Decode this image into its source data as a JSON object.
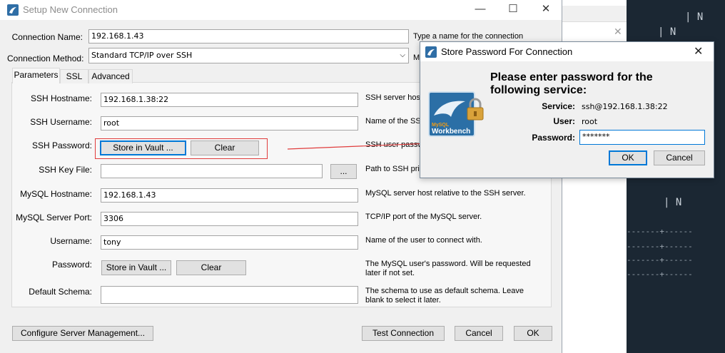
{
  "main": {
    "title": "Setup New Connection",
    "connection_name_label": "Connection Name:",
    "connection_name_value": "192.168.1.43",
    "connection_name_hint": "Type a name for the connection",
    "connection_method_label": "Connection Method:",
    "connection_method_value": "Standard TCP/IP over SSH",
    "connection_method_hint": "M",
    "tabs": [
      {
        "label": "Parameters"
      },
      {
        "label": "SSL"
      },
      {
        "label": "Advanced"
      }
    ],
    "fields": {
      "ssh_hostname_label": "SSH Hostname:",
      "ssh_hostname_value": "192.168.1.38:22",
      "ssh_hostname_hint": "SSH server host",
      "ssh_username_label": "SSH Username:",
      "ssh_username_value": "root",
      "ssh_username_hint": "Name of the SS",
      "ssh_password_label": "SSH Password:",
      "ssh_password_hint": "SSH user passw",
      "ssh_keyfile_label": "SSH Key File:",
      "ssh_keyfile_value": "",
      "ssh_keyfile_hint": "Path to SSH priv",
      "mysql_hostname_label": "MySQL Hostname:",
      "mysql_hostname_value": "192.168.1.43",
      "mysql_hostname_hint": "MySQL server host relative to the SSH server.",
      "mysql_port_label": "MySQL Server Port:",
      "mysql_port_value": "3306",
      "mysql_port_hint": "TCP/IP port of the MySQL server.",
      "username_label": "Username:",
      "username_value": "tony",
      "username_hint": "Name of the user to connect with.",
      "password_label": "Password:",
      "password_hint_1": "The MySQL user's password. Will be requested",
      "password_hint_2": "later if not set.",
      "schema_label": "Default Schema:",
      "schema_value": "",
      "schema_hint_1": "The schema to use as default schema. Leave",
      "schema_hint_2": "blank to select it later."
    },
    "buttons": {
      "store_vault_ssh": "Store in Vault ...",
      "clear_ssh": "Clear",
      "browse": "...",
      "store_vault": "Store in Vault ...",
      "clear": "Clear",
      "configure": "Configure Server Management...",
      "test": "Test Connection",
      "cancel": "Cancel",
      "ok": "OK"
    }
  },
  "password_dialog": {
    "title": "Store Password For Connection",
    "heading": "Please enter password for the following service:",
    "logo_text": "Workbench",
    "logo_small": "MySQL",
    "service_label": "Service:",
    "service_value": "ssh@192.168.1.38:22",
    "user_label": "User:",
    "user_value": "root",
    "password_label": "Password:",
    "password_value": "*******",
    "ok": "OK",
    "cancel": "Cancel"
  },
  "terminal": {
    "lines": [
      "| N",
      "| N",
      "| N"
    ],
    "dash_line": "-------+------"
  },
  "colors": {
    "accent": "#0078d7",
    "highlight": "#e03c3c",
    "terminal_bg": "#1b2733"
  }
}
